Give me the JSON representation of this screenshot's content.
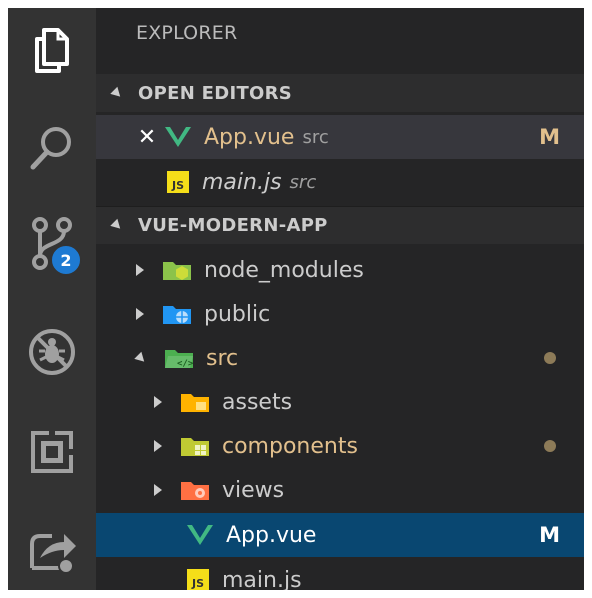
{
  "activity_bar": {
    "items": [
      {
        "name": "explorer",
        "icon": "files-icon"
      },
      {
        "name": "search",
        "icon": "search-icon"
      },
      {
        "name": "source-control",
        "icon": "source-control-icon",
        "badge": "2"
      },
      {
        "name": "debug",
        "icon": "debug-icon"
      },
      {
        "name": "extensions",
        "icon": "extensions-icon"
      },
      {
        "name": "live-share",
        "icon": "live-share-icon"
      }
    ]
  },
  "sidebar": {
    "title": "EXPLORER",
    "open_editors": {
      "header": "OPEN EDITORS",
      "items": [
        {
          "name": "App.vue",
          "folder": "src",
          "status": "M",
          "close": "✕",
          "icon": "vue-icon"
        },
        {
          "name": "main.js",
          "folder": "src",
          "icon": "js-file-icon"
        }
      ]
    },
    "project": {
      "header": "VUE-MODERN-APP",
      "tree": [
        {
          "name": "node_modules",
          "type": "folder",
          "icon": "node-folder-icon"
        },
        {
          "name": "public",
          "type": "folder",
          "icon": "public-folder-icon"
        },
        {
          "name": "src",
          "type": "folder",
          "icon": "src-folder-icon",
          "expanded": true
        },
        {
          "name": "assets",
          "type": "folder",
          "icon": "assets-folder-icon"
        },
        {
          "name": "components",
          "type": "folder",
          "icon": "components-folder-icon"
        },
        {
          "name": "views",
          "type": "folder",
          "icon": "views-folder-icon"
        },
        {
          "name": "App.vue",
          "type": "file",
          "icon": "vue-icon",
          "status": "M"
        },
        {
          "name": "main.js",
          "type": "file",
          "icon": "js-file-icon"
        }
      ]
    }
  },
  "colors": {
    "activity_bg": "#333333",
    "sidebar_bg": "#252526",
    "selection_bg": "#094771",
    "modified_text": "#e2c08d",
    "vue_green": "#41b883",
    "badge_blue": "#1e7ad2"
  }
}
